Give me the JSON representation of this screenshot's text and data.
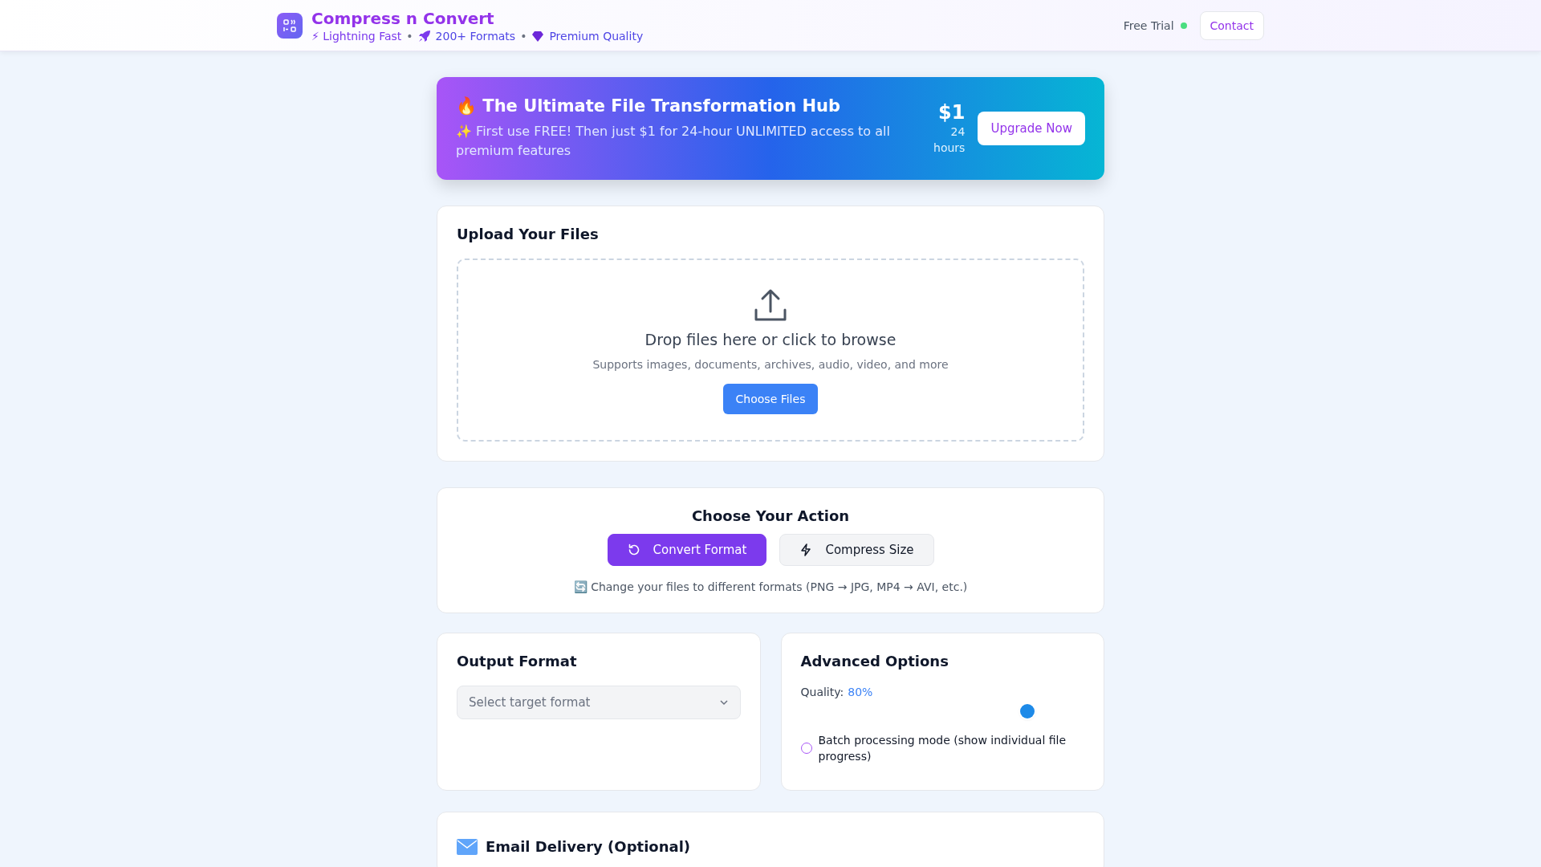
{
  "header": {
    "title": "Compress n Convert",
    "features": [
      {
        "kind": "bolt",
        "label": "⚡ Lightning Fast"
      },
      {
        "kind": "rocket",
        "label": "200+ Formats"
      },
      {
        "kind": "gem",
        "label": "Premium Quality"
      }
    ],
    "separator": "•",
    "status": {
      "label": "Free Trial",
      "online": true
    },
    "contact": "Contact"
  },
  "banner": {
    "title": "🔥 The Ultimate File Transformation Hub",
    "text": "✨ First use FREE! Then just $1 for 24-hour UNLIMITED access to all premium features",
    "price": "$1",
    "period": "24 hours",
    "button": "Upgrade Now"
  },
  "upload": {
    "title": "Upload Your Files",
    "drop_text": "Drop files here or click to browse",
    "hint": "Supports images, documents, archives, audio, video, and more",
    "button": "Choose Files"
  },
  "action": {
    "title": "Choose Your Action",
    "options": [
      {
        "kind": "convert",
        "label": "Convert Format",
        "selected": true
      },
      {
        "kind": "compress",
        "label": "Compress Size",
        "selected": false
      }
    ],
    "description": "🔄 Change your files to different formats (PNG → JPG, MP4 → AVI, etc.)"
  },
  "output": {
    "title": "Output Format",
    "select": {
      "placeholder": "Select target format"
    }
  },
  "advanced": {
    "title": "Advanced Options",
    "quality": {
      "label": "Quality:",
      "reading": "80%",
      "level": 0.8
    },
    "batch": {
      "label": "Batch processing mode (show individual file progress)",
      "checked": false
    }
  },
  "email": {
    "title": "Email Delivery (Optional)"
  }
}
